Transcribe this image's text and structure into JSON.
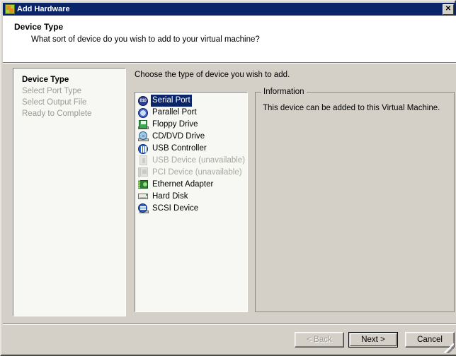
{
  "window": {
    "title": "Add Hardware",
    "title_icon": "add-hardware-icon",
    "close_label": "✕"
  },
  "header": {
    "title": "Device Type",
    "subtitle": "What sort of device do you wish to add to your virtual machine?"
  },
  "steps": [
    {
      "label": "Device Type",
      "state": "current"
    },
    {
      "label": "Select Port Type",
      "state": "pending"
    },
    {
      "label": "Select Output File",
      "state": "pending"
    },
    {
      "label": "Ready to Complete",
      "state": "pending"
    }
  ],
  "main": {
    "prompt": "Choose the type of device you wish to add.",
    "devices": [
      {
        "label": "Serial Port",
        "icon": "serial-port-icon",
        "icon_text": "010",
        "selected": true,
        "disabled": false
      },
      {
        "label": "Parallel Port",
        "icon": "parallel-port-icon",
        "icon_text": "",
        "selected": false,
        "disabled": false
      },
      {
        "label": "Floppy Drive",
        "icon": "floppy-drive-icon",
        "icon_text": "",
        "selected": false,
        "disabled": false
      },
      {
        "label": "CD/DVD Drive",
        "icon": "cd-dvd-drive-icon",
        "icon_text": "",
        "selected": false,
        "disabled": false
      },
      {
        "label": "USB Controller",
        "icon": "usb-controller-icon",
        "icon_text": "",
        "selected": false,
        "disabled": false
      },
      {
        "label": "USB Device (unavailable)",
        "icon": "usb-device-icon",
        "icon_text": "",
        "selected": false,
        "disabled": true
      },
      {
        "label": "PCI Device (unavailable)",
        "icon": "pci-device-icon",
        "icon_text": "",
        "selected": false,
        "disabled": true
      },
      {
        "label": "Ethernet Adapter",
        "icon": "ethernet-adapter-icon",
        "icon_text": "",
        "selected": false,
        "disabled": false
      },
      {
        "label": "Hard Disk",
        "icon": "hard-disk-icon",
        "icon_text": "",
        "selected": false,
        "disabled": false
      },
      {
        "label": "SCSI Device",
        "icon": "scsi-device-icon",
        "icon_text": "",
        "selected": false,
        "disabled": false
      }
    ]
  },
  "information": {
    "legend": "Information",
    "text": "This device can be added to this Virtual Machine."
  },
  "footer": {
    "back_label": "< Back",
    "next_label": "Next >",
    "cancel_label": "Cancel"
  },
  "colors": {
    "titlebar": "#0a246a",
    "dialog_face": "#d4d0c8",
    "selection": "#0a246a",
    "header_background": "#ffffff",
    "disabled_text": "#9b9b94"
  }
}
